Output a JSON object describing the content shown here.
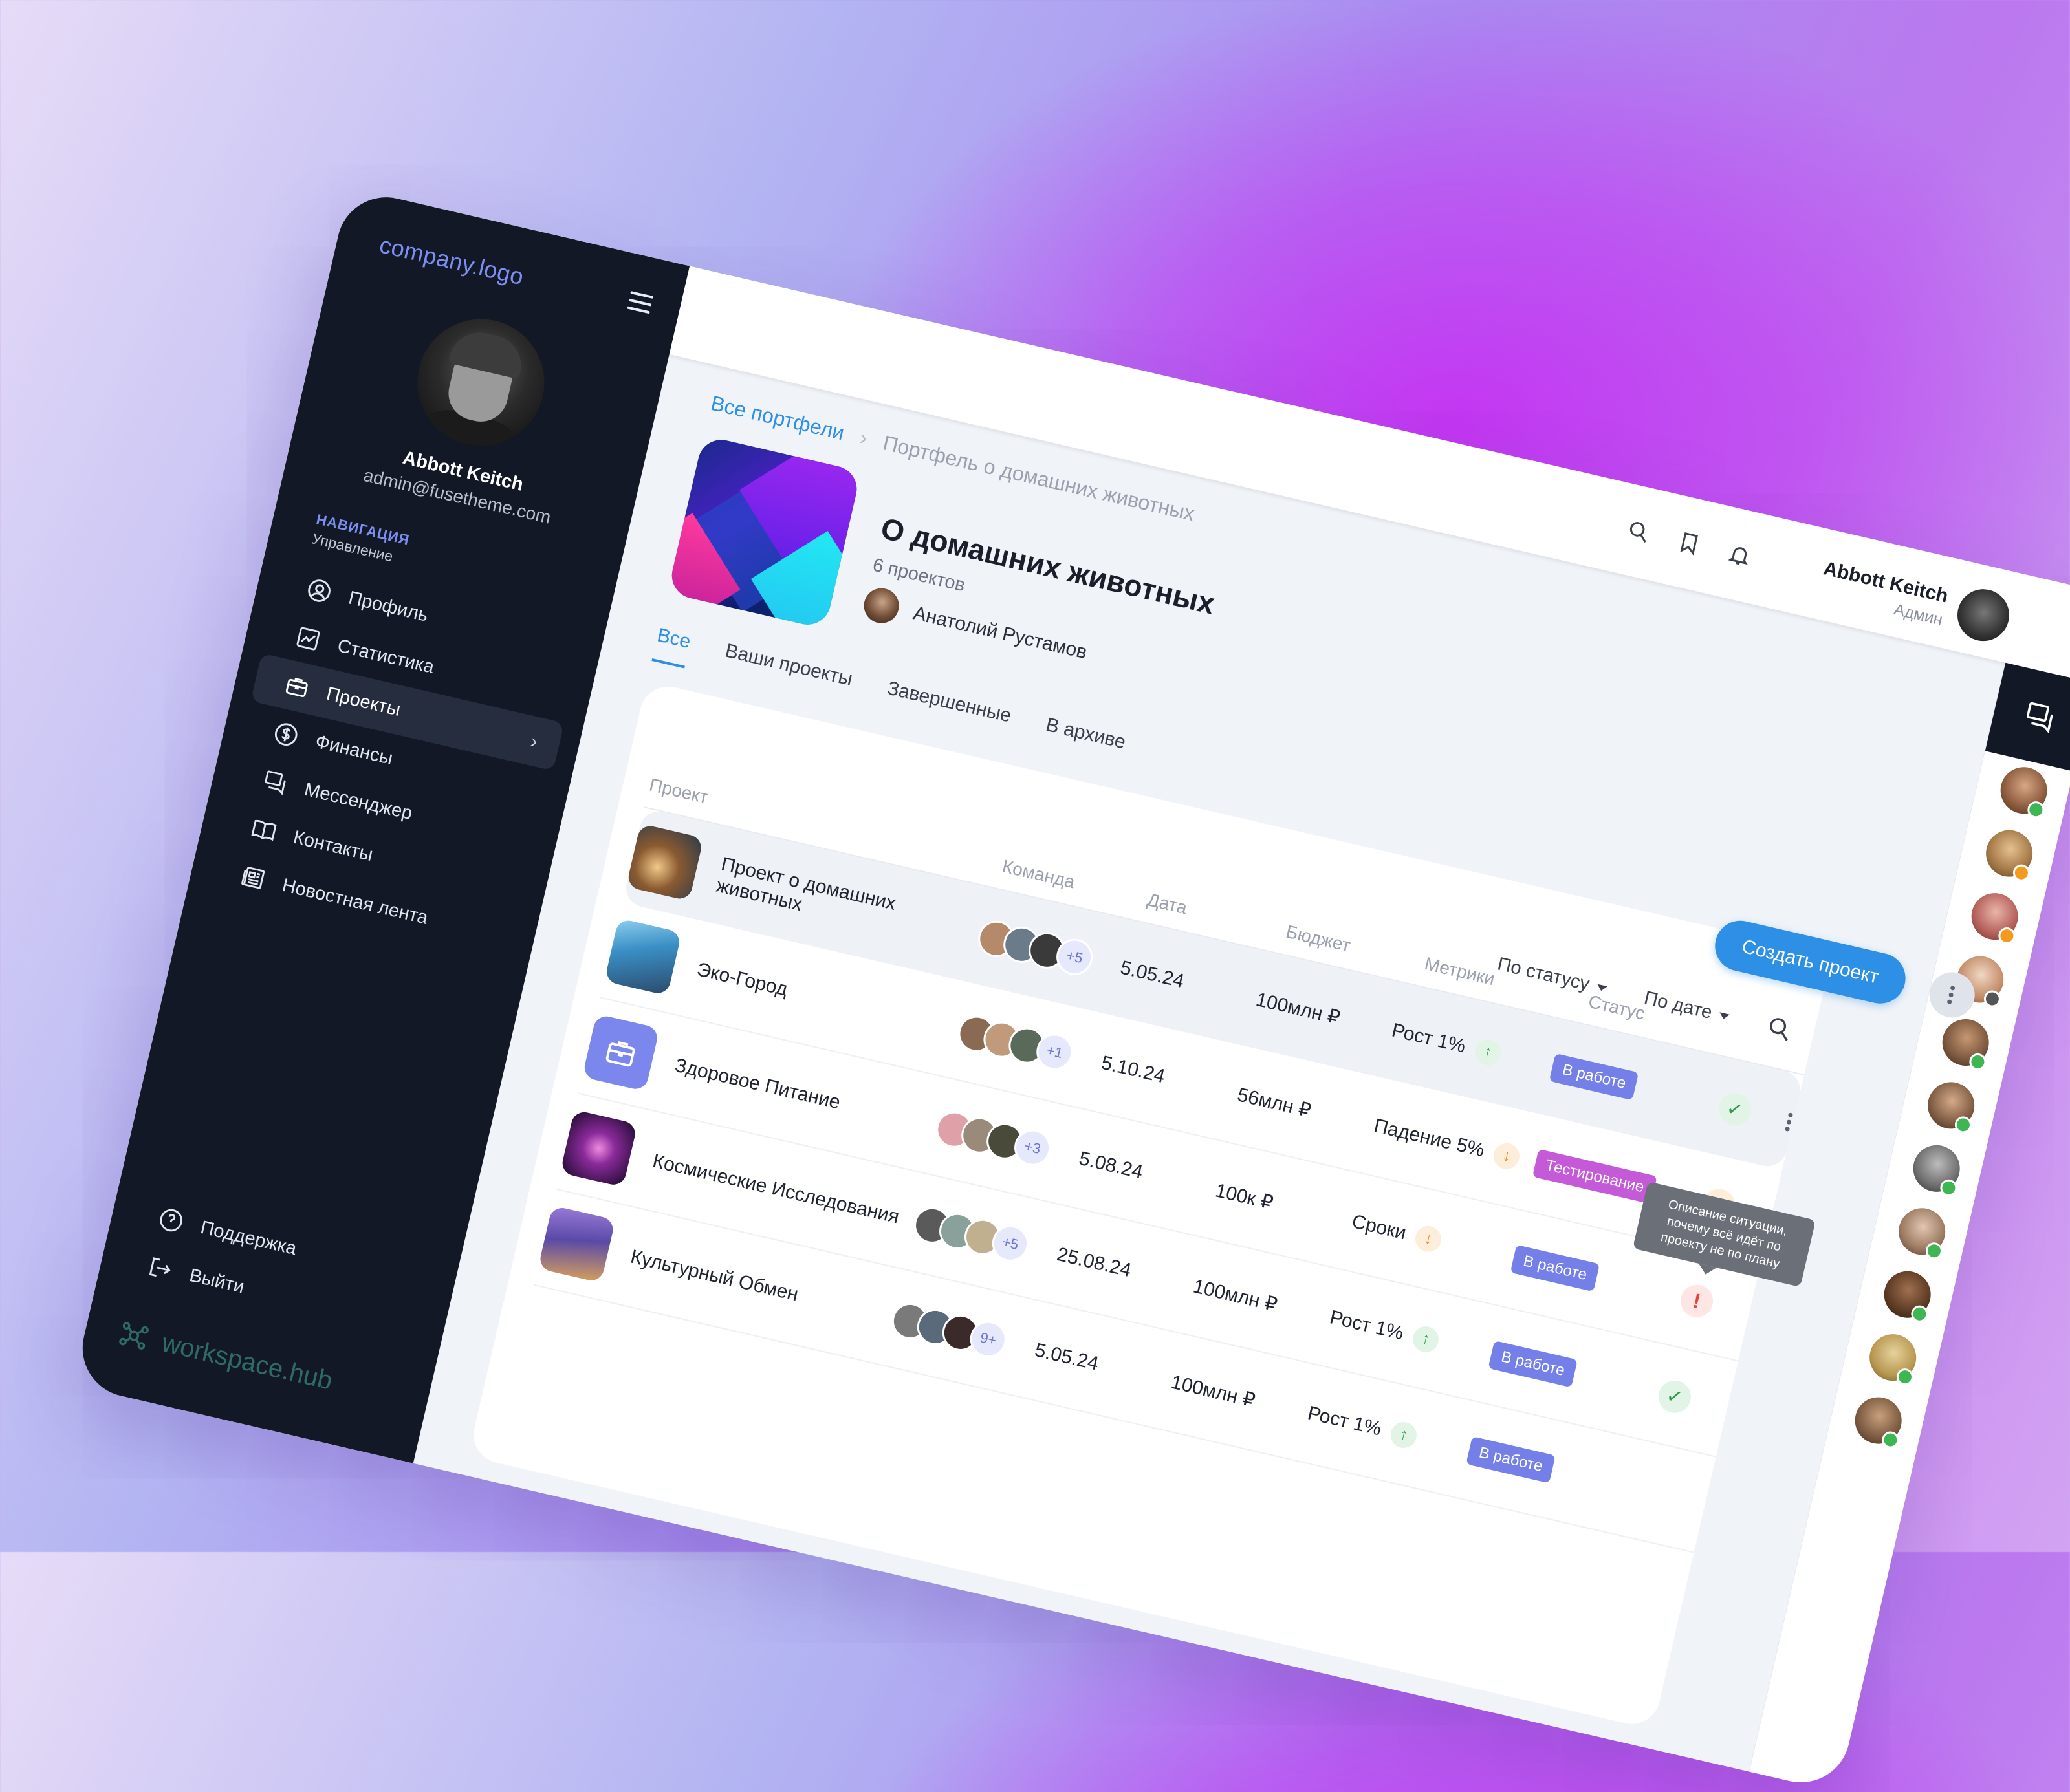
{
  "brand": {
    "logo": "company.logo",
    "footer": "workspace.hub"
  },
  "user": {
    "name": "Abbott Keitch",
    "email": "admin@fusetheme.com",
    "role": "Админ"
  },
  "nav": {
    "heading": "НАВИГАЦИЯ",
    "subheading": "Управление",
    "items": [
      {
        "label": "Профиль",
        "icon": "user-circle-icon"
      },
      {
        "label": "Статистика",
        "icon": "chart-icon"
      },
      {
        "label": "Проекты",
        "icon": "briefcase-icon",
        "active": true
      },
      {
        "label": "Финансы",
        "icon": "dollar-icon"
      },
      {
        "label": "Мессенджер",
        "icon": "chat-icon"
      },
      {
        "label": "Контакты",
        "icon": "book-icon"
      },
      {
        "label": "Новостная лента",
        "icon": "newspaper-icon"
      }
    ],
    "bottom": [
      {
        "label": "Поддержка",
        "icon": "help-icon"
      },
      {
        "label": "Выйти",
        "icon": "logout-icon"
      }
    ]
  },
  "breadcrumb": {
    "root": "Все портфели",
    "current": "Портфель о домашних животных"
  },
  "portfolio": {
    "title": "О домашних животных",
    "count": "6 проектов",
    "owner": "Анатолий Рустамов"
  },
  "tabs": [
    "Все",
    "Ваши проекты",
    "Завершенные",
    "В архиве"
  ],
  "actions": {
    "create": "Создать проект"
  },
  "filters": {
    "status": "По статусу",
    "date": "По дате"
  },
  "columns": {
    "project": "Проект",
    "team": "Команда",
    "date": "Дата",
    "budget": "Бюджет",
    "metrics": "Метрики",
    "status": "Статус"
  },
  "rows": [
    {
      "name": "Проект о домашних животных",
      "team_more": "+5",
      "date": "5.05.24",
      "budget": "100млн ₽",
      "metric": "Рост 1%",
      "trend": "up",
      "status": "В работе",
      "status_kind": "work",
      "check": "ok"
    },
    {
      "name": "Эко-Город",
      "team_more": "+1",
      "date": "5.10.24",
      "budget": "56млн ₽",
      "metric": "Падение 5%",
      "trend": "down",
      "status": "Тестирование",
      "status_kind": "test",
      "check": "warn-orange"
    },
    {
      "name": "Здоровое Питание",
      "team_more": "+3",
      "date": "5.08.24",
      "budget": "100к ₽",
      "metric": "Сроки",
      "trend": "down",
      "status": "В работе",
      "status_kind": "work",
      "check": "warn-red"
    },
    {
      "name": "Космические Исследования",
      "team_more": "+5",
      "date": "25.08.24",
      "budget": "100млн ₽",
      "metric": "Рост 1%",
      "trend": "up",
      "status": "В работе",
      "status_kind": "work",
      "check": "ok"
    },
    {
      "name": "Культурный Обмен",
      "team_more": "9+",
      "date": "5.05.24",
      "budget": "100млн ₽",
      "metric": "Рост 1%",
      "trend": "up",
      "status": "В работе",
      "status_kind": "work",
      "check": ""
    }
  ],
  "tooltip": "Описание ситуации, почему всё идёт по проекту не по плану",
  "colors": {
    "accent": "#2e8fe6",
    "sidebar": "#121826",
    "work": "#7480e8",
    "test": "#c45ad7",
    "up": "#2e9b4a",
    "down": "#e88a1c",
    "alert": "#e5423c"
  }
}
